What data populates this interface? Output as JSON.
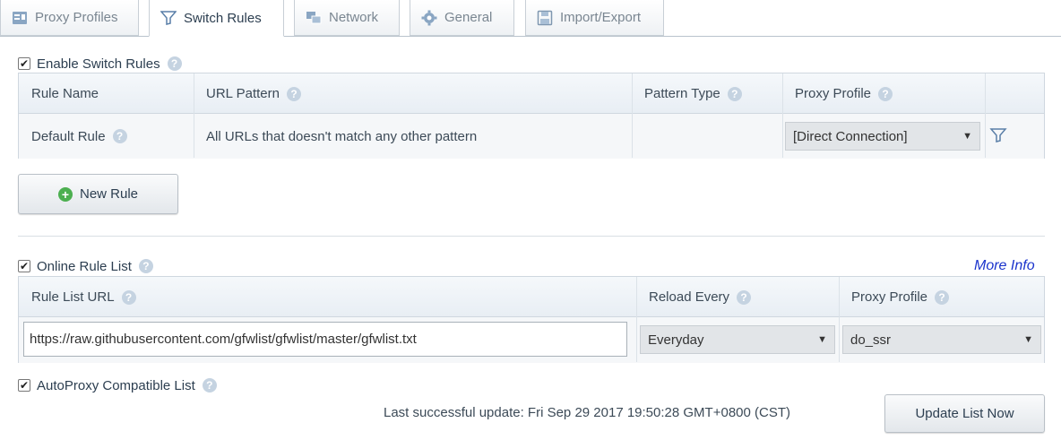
{
  "tabs": [
    {
      "label": "Proxy Profiles",
      "icon": "profiles-icon"
    },
    {
      "label": "Switch Rules",
      "icon": "filter-icon"
    },
    {
      "label": "Network",
      "icon": "network-icon"
    },
    {
      "label": "General",
      "icon": "gear-icon"
    },
    {
      "label": "Import/Export",
      "icon": "floppy-icon"
    }
  ],
  "switch_rules": {
    "enable_label": "Enable Switch Rules",
    "enabled": true,
    "columns": [
      "Rule Name",
      "URL Pattern",
      "Pattern Type",
      "Proxy Profile"
    ],
    "default_rule": {
      "name": "Default Rule",
      "pattern": "All URLs that doesn't match any other pattern",
      "profile": "[Direct Connection]"
    },
    "new_rule_label": "New Rule"
  },
  "online_list": {
    "enable_label": "Online Rule List",
    "enabled": true,
    "more_info": "More Info",
    "columns": [
      "Rule List URL",
      "Reload Every",
      "Proxy Profile"
    ],
    "url": "https://raw.githubusercontent.com/gfwlist/gfwlist/master/gfwlist.txt",
    "reload": "Everyday",
    "profile": "do_ssr",
    "autoproxy_label": "AutoProxy Compatible List",
    "autoproxy_checked": true,
    "last_update": "Last successful update: Fri Sep 29 2017 19:50:28 GMT+0800 (CST)",
    "update_button": "Update List Now"
  },
  "colors": {
    "accent_link": "#1a33cc",
    "help_icon": "#c5d3e1",
    "add_icon": "#4caf50"
  }
}
